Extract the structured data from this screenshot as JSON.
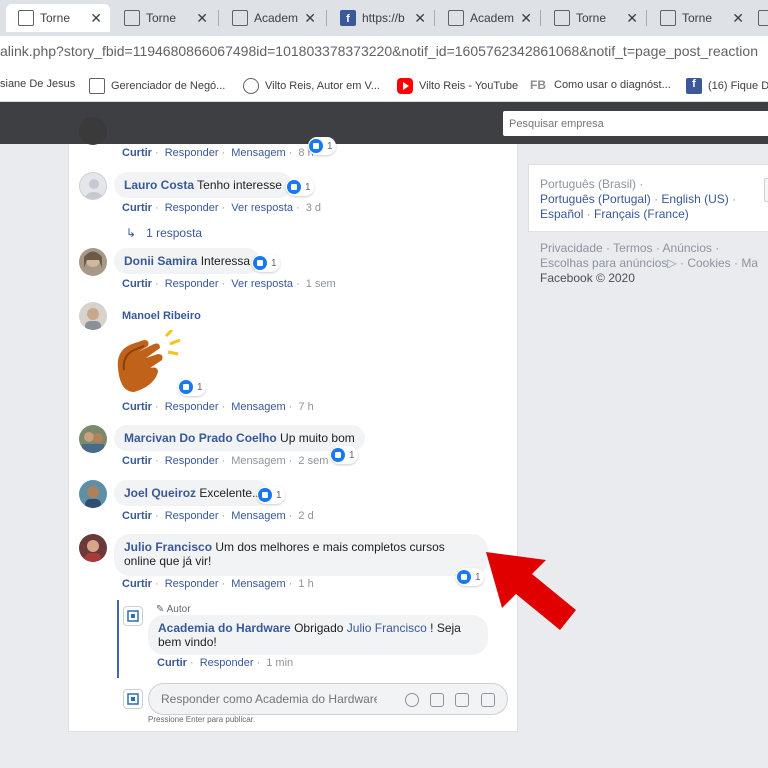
{
  "browser": {
    "tabs": [
      {
        "title": "Torne",
        "active": true
      },
      {
        "title": "Torne",
        "active": false
      },
      {
        "title": "Academ",
        "active": false
      },
      {
        "title": "https://b",
        "active": false,
        "icon": "facebook-icon"
      },
      {
        "title": "Academ",
        "active": false
      },
      {
        "title": "Torne",
        "active": false
      },
      {
        "title": "Torne",
        "active": false
      }
    ],
    "url": "alink.php?story_fbid=1194680866067498id=101803378373220&notif_id=1605762342861068&notif_t=page_post_reaction",
    "bookmarks": [
      {
        "label": "siane De Jesus",
        "icon": "none"
      },
      {
        "label": "Gerenciador de Negó...",
        "icon": "doc-icon"
      },
      {
        "label": "Vilto Reis, Autor em V...",
        "icon": "globe-icon"
      },
      {
        "label": "Vilto Reis - YouTube",
        "icon": "youtube-icon"
      },
      {
        "label": "Como usar o diagnóst...",
        "prefix": "FB",
        "icon": "fb-text-icon"
      },
      {
        "label": "(16) Fique D",
        "icon": "facebook-icon"
      }
    ]
  },
  "topbar": {
    "search_placeholder": "Pesquisar empresa"
  },
  "comments": [
    {
      "name": "Lauro Costa",
      "text": "Tenho interesse",
      "reactions": "1",
      "actions": [
        "Curtir",
        "Responder",
        "Ver resposta"
      ],
      "time": "3 d",
      "reply_count": "1 resposta"
    },
    {
      "name": "Donii Samira",
      "text": "Interessa",
      "reactions": "1",
      "actions": [
        "Curtir",
        "Responder",
        "Ver resposta"
      ],
      "time": "1 sem"
    },
    {
      "name": "Manoel Ribeiro",
      "text": "",
      "sticker": "clapping-hands",
      "reactions": "1",
      "actions": [
        "Curtir",
        "Responder",
        "Mensagem"
      ],
      "time": "7 h"
    },
    {
      "name": "Marcivan Do Prado Coelho",
      "text": "Up muito bom",
      "reactions": "1",
      "actions": [
        "Curtir",
        "Responder",
        "Mensagem"
      ],
      "time": "2 sem"
    },
    {
      "name": "Joel Queiroz",
      "text": "Excelente..",
      "reactions": "1",
      "actions": [
        "Curtir",
        "Responder",
        "Mensagem"
      ],
      "time": "2 d"
    },
    {
      "name": "Julio Francisco",
      "text": "Um dos melhores e mais completos cursos online que já vir!",
      "reactions": "1",
      "actions": [
        "Curtir",
        "Responder",
        "Mensagem"
      ],
      "time": "1 h"
    }
  ],
  "top_partial": {
    "actions": [
      "Curtir",
      "Responder",
      "Mensagem"
    ],
    "time": "8 h",
    "reactions": "1"
  },
  "page_reply": {
    "author_tag": "Autor",
    "name": "Academia do Hardware",
    "text_before": "Obrigado",
    "mention": "Julio Francisco",
    "text_after": "! Seja bem vindo!",
    "actions": [
      "Curtir",
      "Responder"
    ],
    "time": "1 min"
  },
  "composer": {
    "placeholder": "Responder como Academia do Hardware",
    "hint": "Pressione Enter para publicar."
  },
  "sidebar": {
    "current_language": "Português (Brasil)",
    "languages": [
      "Português (Portugal)",
      "English (US)",
      "Español",
      "Français (France)"
    ],
    "footer_links": [
      "Privacidade",
      "Termos",
      "Anúncios",
      "Escolhas para anúncios",
      "Cookies",
      "Ma"
    ],
    "copyright": "Facebook © 2020"
  },
  "colors": {
    "link": "#385898",
    "arrow": "#e00000",
    "like": "#1877f2"
  }
}
